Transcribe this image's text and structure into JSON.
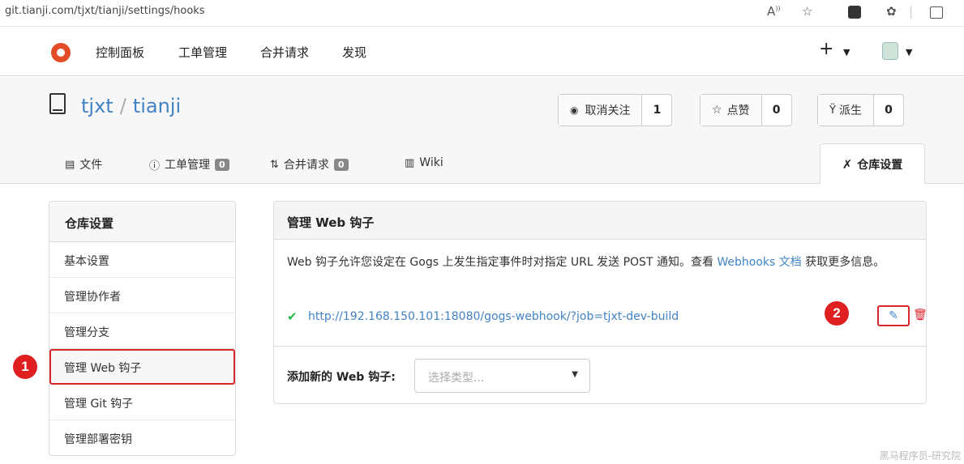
{
  "browser": {
    "url": "git.tianji.com/tjxt/tianji/settings/hooks",
    "icons": [
      "read-aloud-icon",
      "favorite-star-icon",
      "extension-icon",
      "copilot-icon",
      "split-screen-icon"
    ]
  },
  "topnav": {
    "items": [
      "控制面板",
      "工单管理",
      "合并请求",
      "发现"
    ],
    "plus_label": "+"
  },
  "repo": {
    "owner": "tjxt",
    "separator": "/",
    "name": "tianji",
    "actions": [
      {
        "label": "取消关注",
        "count": "1",
        "icon": "eye-icon"
      },
      {
        "label": "点赞",
        "count": "0",
        "icon": "star-icon"
      },
      {
        "label": "派生",
        "count": "0",
        "icon": "fork-icon"
      }
    ],
    "tabs": [
      {
        "label": "文件",
        "icon": "file-icon"
      },
      {
        "label": "工单管理",
        "badge": "0",
        "icon": "issue-icon"
      },
      {
        "label": "合并请求",
        "badge": "0",
        "icon": "pull-request-icon"
      },
      {
        "label": "Wiki",
        "icon": "wiki-icon"
      }
    ],
    "settings_tab": "仓库设置"
  },
  "sidebar": {
    "title": "仓库设置",
    "items": [
      "基本设置",
      "管理协作者",
      "管理分支",
      "管理 Web 钩子",
      "管理 Git 钩子",
      "管理部署密钥"
    ]
  },
  "main": {
    "title": "管理 Web 钩子",
    "desc_before": "Web 钩子允许您设定在 Gogs 上发生指定事件时对指定 URL 发送 POST 通知。查看 ",
    "desc_link": "Webhooks 文档",
    "desc_after": " 获取更多信息。",
    "hook_url": "http://192.168.150.101:18080/gogs-webhook/?job=tjxt-dev-build",
    "add_label": "添加新的 Web 钩子:",
    "select_placeholder": "选择类型..."
  },
  "markers": [
    "1",
    "2"
  ],
  "watermark": "黑马程序员-研究院",
  "colors": {
    "accent": "#4183c4",
    "highlight": "#d9262c",
    "success": "#21ba45"
  }
}
